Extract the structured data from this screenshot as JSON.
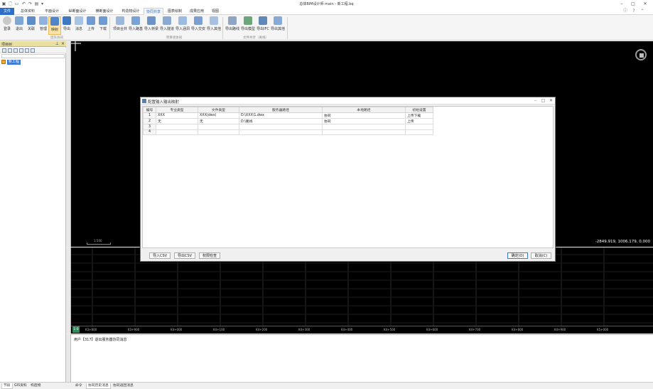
{
  "window": {
    "title": "总体BIM设计师 main - 新工程.bq"
  },
  "ribbon_tabs": [
    "文件",
    "总体资料",
    "平面设计",
    "纵断面设计",
    "横断面设计",
    "构造物设计",
    "协同共享",
    "图表绘制",
    "成果应用",
    "视图"
  ],
  "ribbon_groups": [
    {
      "label": "团队协同",
      "buttons": [
        "登录",
        "退出",
        "关联",
        "管理",
        "映射",
        "导出",
        "消息",
        "上传",
        "下载"
      ]
    },
    {
      "label": "项目组协同",
      "buttons": [
        "项目合并",
        "导入路基",
        "导入桥梁",
        "导入隧道",
        "导入涵洞",
        "导入交安",
        "导入其他"
      ]
    },
    {
      "label": "文件共享（离线）",
      "buttons": [
        "导出路线",
        "导出模型",
        "导出IFC",
        "导出其他"
      ]
    }
  ],
  "left_panel": {
    "title": "项目树",
    "node": "新工程"
  },
  "viewport": {
    "coords": "-2849.919, 1006.179, 0.000",
    "scale_label": "1:500"
  },
  "profile": {
    "badge": "1:0",
    "ticks": [
      "K3+800",
      "K3+900",
      "K4+000",
      "K4+100",
      "K4+200",
      "K4+300",
      "K4+400",
      "K4+500",
      "K4+600",
      "K4+700",
      "K4+800",
      "K4+900",
      "K5+000"
    ]
  },
  "output": {
    "message": "用户【317】退出服务器协同消息"
  },
  "bottom_tabs": {
    "left": [
      "节段",
      "GIS资料",
      "构造物"
    ],
    "right": [
      "命令",
      "协同历史消息",
      "协同返回消息"
    ]
  },
  "dialog": {
    "title": "配置输入输出映射",
    "columns": [
      "编号",
      "专业类型",
      "文件类型",
      "服务器路径",
      "本地路径",
      "初始设置"
    ],
    "rows": [
      [
        "1",
        "XXX",
        "XXX(dwx)",
        "D:\\XXX\\1.dwx",
        "协同",
        "上传下载"
      ],
      [
        "2",
        "无",
        "无",
        "D:\\路线",
        "协同",
        "上传"
      ],
      [
        "3",
        "",
        "",
        "",
        "",
        ""
      ],
      [
        "4",
        "",
        "",
        "",
        "",
        ""
      ]
    ],
    "buttons": {
      "import": "导入CSV",
      "export": "导出CSV",
      "check": "权限检查",
      "ok": "确定(O)",
      "cancel": "取消(C)"
    }
  }
}
